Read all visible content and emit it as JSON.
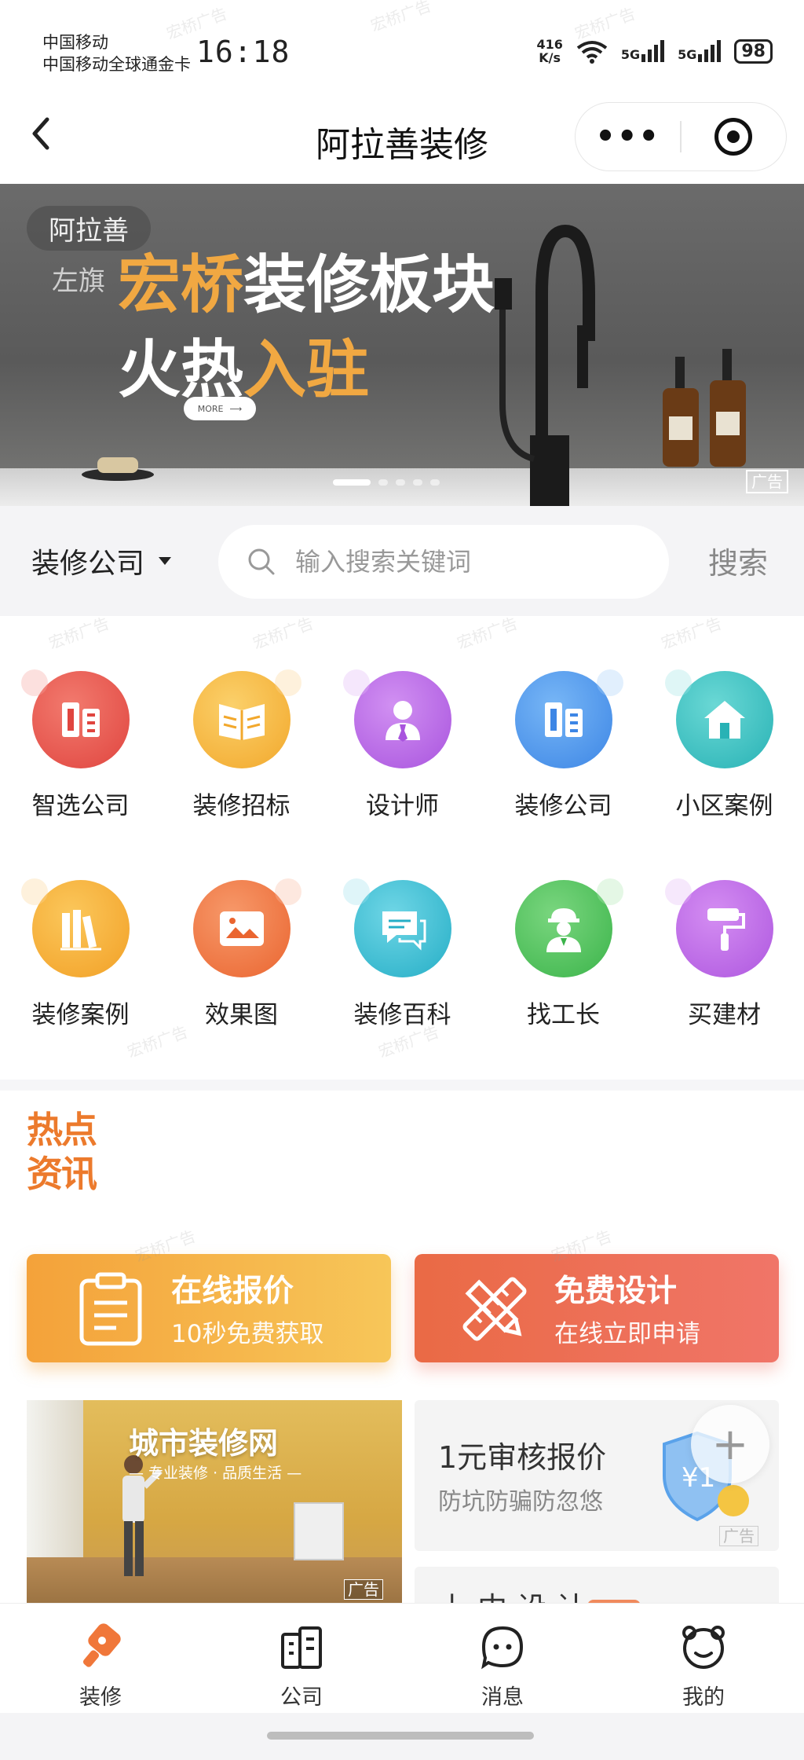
{
  "status_bar": {
    "carrier_line1": "中国移动",
    "carrier_line2": "中国移动全球通金卡",
    "time": "16:18",
    "net_speed_value": "416",
    "net_speed_unit": "K/s",
    "signal1": "5G",
    "signal2": "5G",
    "battery": "98"
  },
  "navbar": {
    "title": "阿拉善装修",
    "more_label": "•••"
  },
  "banner": {
    "location_line1": "阿拉善",
    "location_line2": "左旗",
    "headline_gold": "宏桥",
    "headline_white": "装修板块",
    "subline_white": "火热",
    "subline_gold": "入驻",
    "more_label": "MORE",
    "ad_label": "广告",
    "watermark": "宏桥广告"
  },
  "search": {
    "category": "装修公司",
    "placeholder": "输入搜索关键词",
    "button": "搜索"
  },
  "grid": {
    "items": [
      {
        "label": "智选公司",
        "icon": "company-building-icon",
        "color": "#e85454"
      },
      {
        "label": "装修招标",
        "icon": "book-icon",
        "color": "#f5b93c"
      },
      {
        "label": "设计师",
        "icon": "designer-person-icon",
        "color": "#b968e6"
      },
      {
        "label": "装修公司",
        "icon": "company-building-icon",
        "color": "#4b9bef"
      },
      {
        "label": "小区案例",
        "icon": "house-icon",
        "color": "#33c1c1"
      },
      {
        "label": "装修案例",
        "icon": "books-icon",
        "color": "#f6b236"
      },
      {
        "label": "效果图",
        "icon": "picture-icon",
        "color": "#f07a43"
      },
      {
        "label": "装修百科",
        "icon": "chat-bubble-icon",
        "color": "#3cbfd6"
      },
      {
        "label": "找工长",
        "icon": "worker-icon",
        "color": "#4bc25b"
      },
      {
        "label": "买建材",
        "icon": "paint-roller-icon",
        "color": "#bd6be6"
      }
    ]
  },
  "hot_news": {
    "line1": "热点",
    "line2": "资讯"
  },
  "promo": {
    "quote_title": "在线报价",
    "quote_sub": "10秒免费获取",
    "design_title": "免费设计",
    "design_sub": "在线立即申请"
  },
  "ads": {
    "city_title": "城市装修网",
    "city_sub": "— 专业装修 · 品质生活 —",
    "city_ad": "广告",
    "audit_title": "1元审核报价",
    "audit_sub": "防坑防骗防忽悠",
    "audit_badge": "¥1",
    "audit_ad": "广告",
    "design_partial": "上 中 设 计"
  },
  "tabbar": {
    "tabs": [
      {
        "label": "装修"
      },
      {
        "label": "公司"
      },
      {
        "label": "消息"
      },
      {
        "label": "我的"
      }
    ]
  },
  "colors": {
    "accent_orange": "#ec7a2c",
    "quote_card": "#f4a23a",
    "design_card": "#ea6a45"
  }
}
